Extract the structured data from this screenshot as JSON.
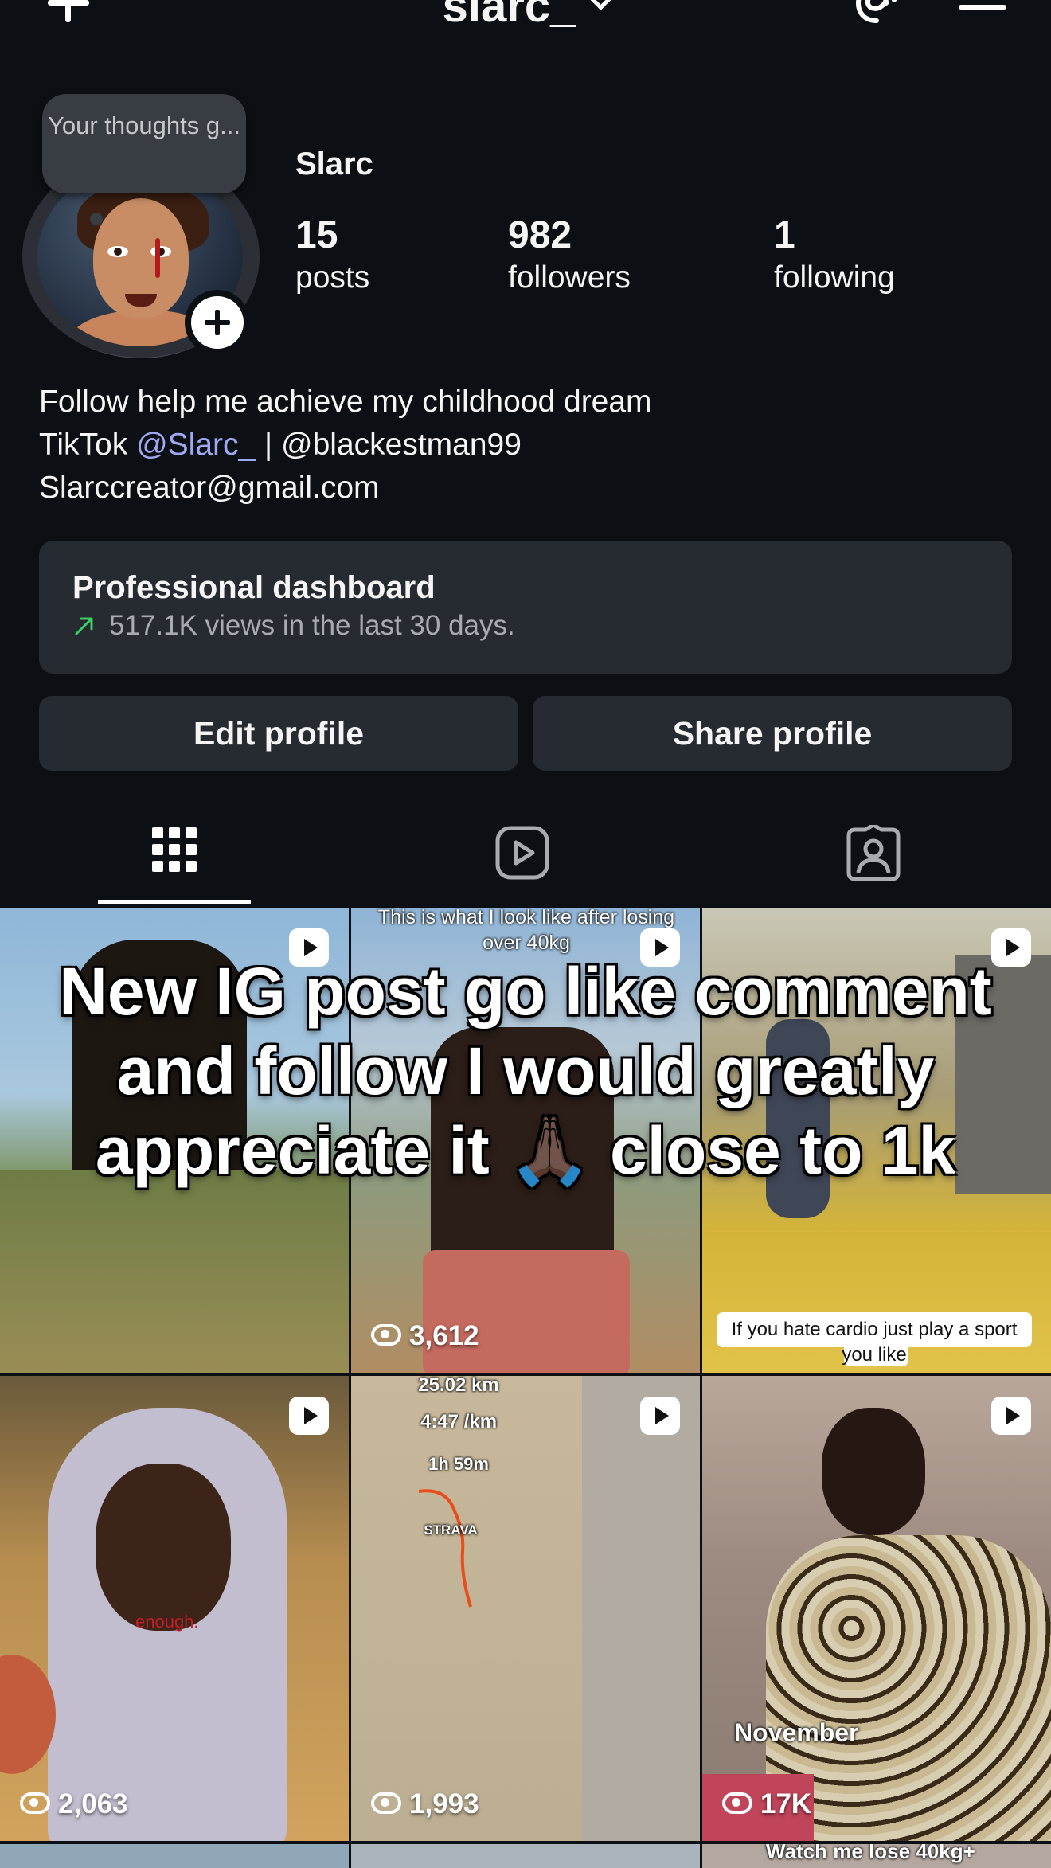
{
  "header": {
    "username": "slarc_"
  },
  "note": {
    "text": "Your thoughts g..."
  },
  "profile": {
    "display_name": "Slarc",
    "posts_count": "15",
    "posts_label": "posts",
    "followers_count": "982",
    "followers_label": "followers",
    "following_count": "1",
    "following_label": "following",
    "bio_line1": "Follow help me achieve my childhood dream",
    "bio_line2_prefix": "TikTok ",
    "bio_line2_link": "@Slarc_",
    "bio_line2_suffix": " | @blackestman99",
    "bio_line3": "Slarccreator@gmail.com"
  },
  "dashboard": {
    "title": "Professional dashboard",
    "subtitle": "517.1K views in the last 30 days."
  },
  "buttons": {
    "edit": "Edit profile",
    "share": "Share profile"
  },
  "tabs": {
    "active": "grid"
  },
  "grid": {
    "posts": [
      {
        "caption_top": "",
        "views": ""
      },
      {
        "caption_top": "This is what I look like after losing over 40kg",
        "views": "3,612"
      },
      {
        "caption_bottom": "If you hate cardio just play a sport you like",
        "views": ""
      },
      {
        "caption_mid": "enough.",
        "views": "2,063"
      },
      {
        "strava_distance": "25.02 km",
        "strava_pace": "4:47 /km",
        "strava_time": "1h 59m",
        "strava_brand": "STRAVA",
        "views": "1,993"
      },
      {
        "caption_mid": "November",
        "views": "17K"
      }
    ],
    "next_row_caption": "Watch me lose 40kg+"
  },
  "overlay_text": "New IG post go like comment and follow I would greatly appreciate it 🙏🏿 close to 1k",
  "colors": {
    "background": "#0c1014",
    "card": "#262a31",
    "link": "#a0a8f3",
    "trend": "#3ccf64"
  }
}
